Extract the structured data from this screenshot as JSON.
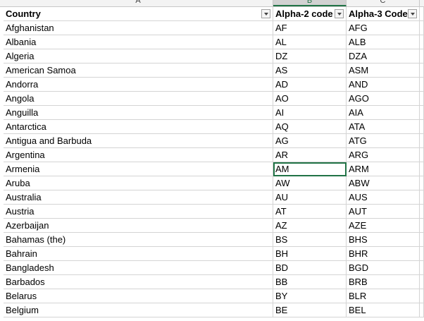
{
  "columns": [
    "A",
    "B",
    "C"
  ],
  "headers": {
    "country": "Country",
    "alpha2": "Alpha-2 code",
    "alpha3": "Alpha-3 Code"
  },
  "rows": [
    {
      "country": "Afghanistan",
      "alpha2": "AF",
      "alpha3": "AFG"
    },
    {
      "country": "Albania",
      "alpha2": "AL",
      "alpha3": "ALB"
    },
    {
      "country": "Algeria",
      "alpha2": "DZ",
      "alpha3": "DZA"
    },
    {
      "country": "American Samoa",
      "alpha2": "AS",
      "alpha3": "ASM"
    },
    {
      "country": "Andorra",
      "alpha2": "AD",
      "alpha3": "AND"
    },
    {
      "country": "Angola",
      "alpha2": "AO",
      "alpha3": "AGO"
    },
    {
      "country": "Anguilla",
      "alpha2": "AI",
      "alpha3": "AIA"
    },
    {
      "country": "Antarctica",
      "alpha2": "AQ",
      "alpha3": "ATA"
    },
    {
      "country": "Antigua and Barbuda",
      "alpha2": "AG",
      "alpha3": "ATG"
    },
    {
      "country": "Argentina",
      "alpha2": "AR",
      "alpha3": "ARG"
    },
    {
      "country": "Armenia",
      "alpha2": "AM",
      "alpha3": "ARM"
    },
    {
      "country": "Aruba",
      "alpha2": "AW",
      "alpha3": "ABW"
    },
    {
      "country": "Australia",
      "alpha2": "AU",
      "alpha3": "AUS"
    },
    {
      "country": "Austria",
      "alpha2": "AT",
      "alpha3": "AUT"
    },
    {
      "country": "Azerbaijan",
      "alpha2": "AZ",
      "alpha3": "AZE"
    },
    {
      "country": "Bahamas (the)",
      "alpha2": "BS",
      "alpha3": "BHS"
    },
    {
      "country": "Bahrain",
      "alpha2": "BH",
      "alpha3": "BHR"
    },
    {
      "country": "Bangladesh",
      "alpha2": "BD",
      "alpha3": "BGD"
    },
    {
      "country": "Barbados",
      "alpha2": "BB",
      "alpha3": "BRB"
    },
    {
      "country": "Belarus",
      "alpha2": "BY",
      "alpha3": "BLR"
    },
    {
      "country": "Belgium",
      "alpha2": "BE",
      "alpha3": "BEL"
    }
  ],
  "selected_column": "B",
  "active_row_index": 10,
  "colors": {
    "accent": "#217346"
  }
}
